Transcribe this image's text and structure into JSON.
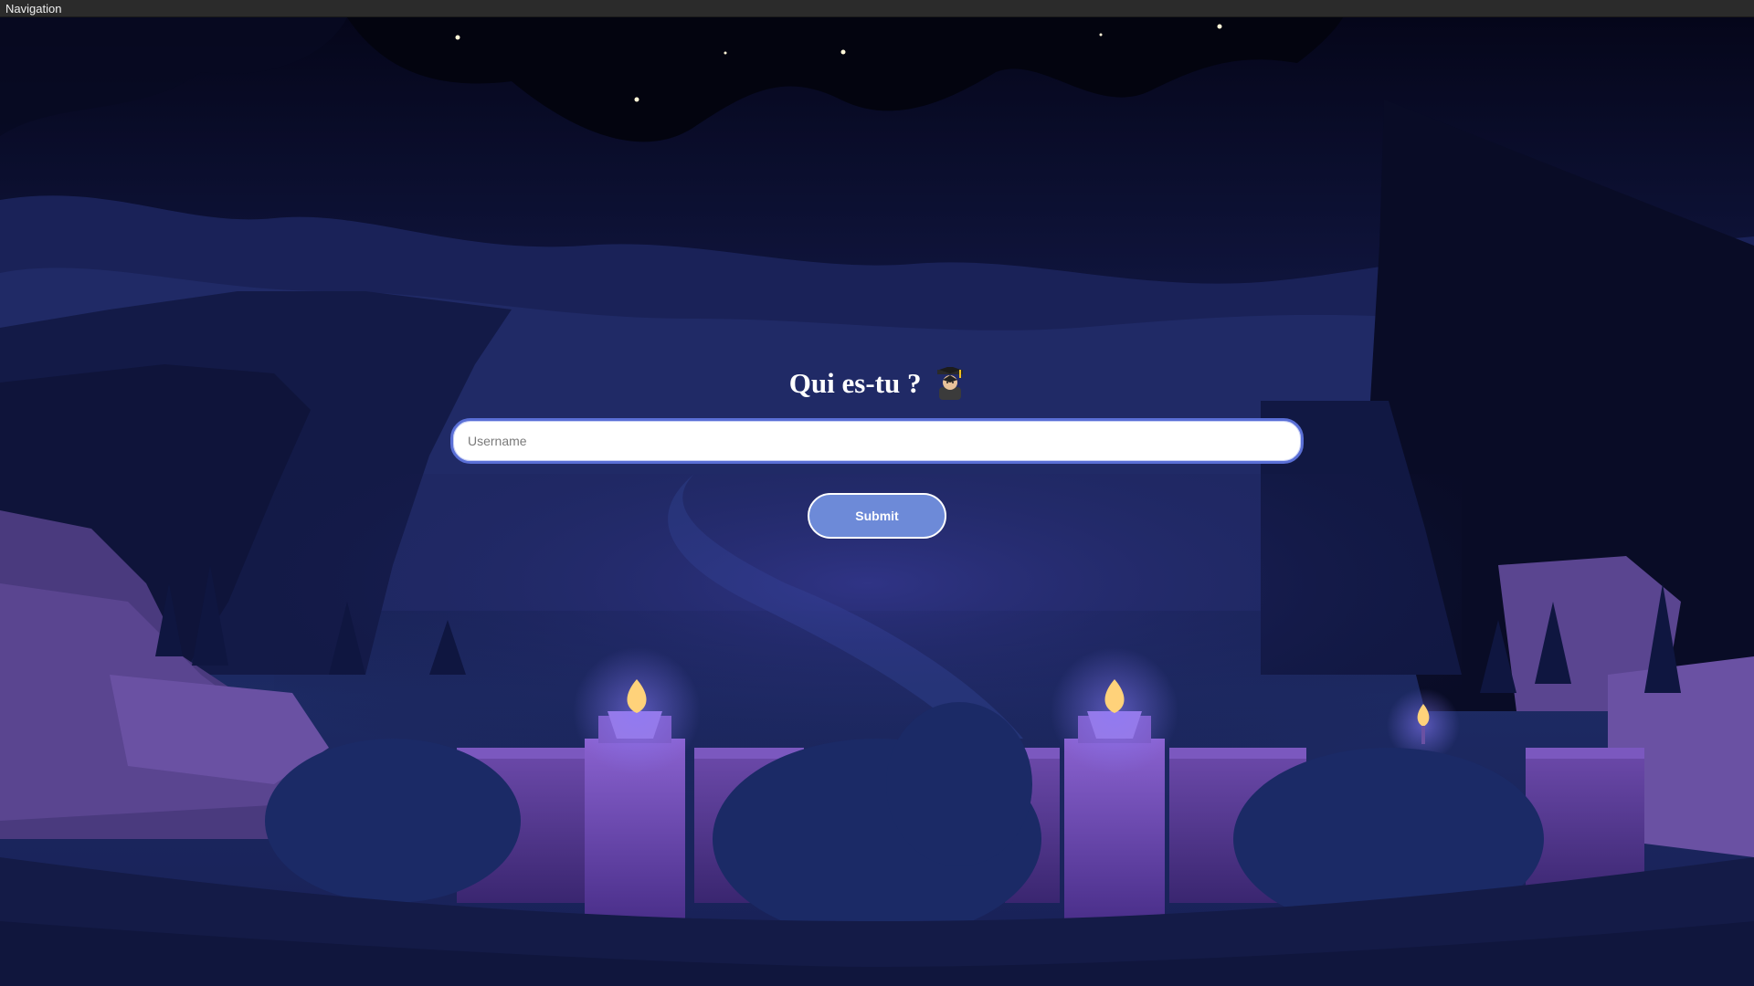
{
  "window": {
    "title": "Navigation"
  },
  "form": {
    "title": "Qui es-tu ?",
    "title_icon": "graduate-icon",
    "username_placeholder": "Username",
    "username_value": "",
    "submit_label": "Submit"
  },
  "background": {
    "description_icon": "night-valley-illustration",
    "colors": {
      "sky_top": "#05061a",
      "sky_mid": "#1b2458",
      "ground": "#141b47",
      "wall": "#5a3a8f",
      "flame": "#ffd27a",
      "accent": "#6d8ad8"
    }
  }
}
